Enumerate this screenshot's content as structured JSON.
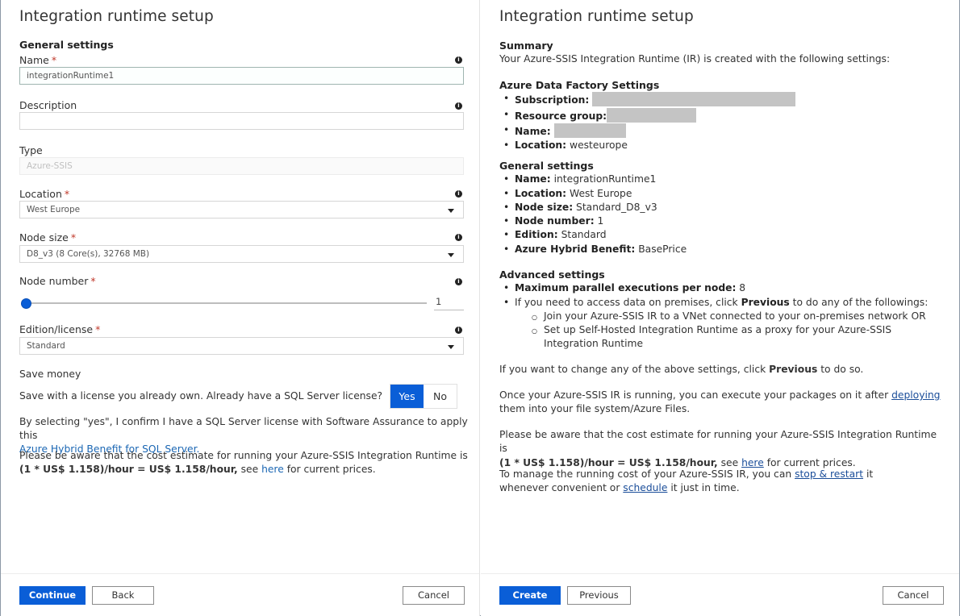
{
  "left_panel": {
    "title": "Integration runtime setup",
    "section": "General settings",
    "required_mark": "*",
    "info_glyph": "i",
    "fields": {
      "name": {
        "label": "Name",
        "value": "integrationRuntime1"
      },
      "description": {
        "label": "Description",
        "value": ""
      },
      "type": {
        "label": "Type",
        "value": "Azure-SSIS"
      },
      "location": {
        "label": "Location",
        "value": "West Europe"
      },
      "node_size": {
        "label": "Node size",
        "value": "D8_v3 (8 Core(s), 32768 MB)"
      },
      "node_number": {
        "label": "Node number",
        "value": "1",
        "slider_fraction": 0.0
      },
      "edition": {
        "label": "Edition/license",
        "value": "Standard"
      }
    },
    "save_money": {
      "heading": "Save money",
      "question": "Save with a license you already own. Already have a SQL Server license?",
      "yes_label": "Yes",
      "no_label": "No",
      "selected": "Yes",
      "confirm_text": "By selecting \"yes\", I confirm I have a SQL Server license with Software Assurance to apply this",
      "confirm_link": "Azure Hybrid Benefit for SQL Server."
    },
    "cost": {
      "prefix": "Please be aware that the cost estimate for running your Azure-SSIS Integration Runtime is",
      "formula": "(1 * US$ 1.158)/hour = US$ 1.158/hour,",
      "see": " see ",
      "link": "here",
      "suffix": " for current prices."
    },
    "buttons": {
      "continue": "Continue",
      "back": "Back",
      "cancel": "Cancel"
    }
  },
  "right_panel": {
    "title": "Integration runtime setup",
    "summary_heading": "Summary",
    "summary_intro": "Your Azure-SSIS Integration Runtime (IR) is created with the following settings:",
    "adf_heading": "Azure Data Factory Settings",
    "adf": [
      {
        "key": "Subscription:",
        "value": "",
        "redacted": true
      },
      {
        "key": "Resource group:",
        "value": "",
        "redacted": true
      },
      {
        "key": "Name:",
        "value": "",
        "redacted": true
      },
      {
        "key": "Location:",
        "value": "westeurope",
        "redacted": false
      }
    ],
    "general_heading": "General settings",
    "general": [
      {
        "key": "Name:",
        "value": "integrationRuntime1"
      },
      {
        "key": "Location:",
        "value": "West Europe"
      },
      {
        "key": "Node size:",
        "value": "Standard_D8_v3"
      },
      {
        "key": "Node number:",
        "value": "1"
      },
      {
        "key": "Edition:",
        "value": "Standard"
      },
      {
        "key": "Azure Hybrid Benefit:",
        "value": "BasePrice"
      }
    ],
    "advanced_heading": "Advanced settings",
    "advanced": {
      "max_parallel_key": "Maximum parallel executions per node:",
      "max_parallel_value": "8",
      "onprem_prefix": "If you need to access data on premises, click ",
      "onprem_bold": "Previous",
      "onprem_suffix": " to do any of the followings:",
      "sub_items": [
        "Join your Azure-SSIS IR to a VNet connected to your on-premises network OR",
        "Set up Self-Hosted Integration Runtime as a proxy for your Azure-SSIS Integration Runtime"
      ]
    },
    "change_prefix": "If you want to change any of the above settings, click ",
    "change_bold": "Previous",
    "change_suffix": " to do so.",
    "deploy_prefix": "Once your Azure-SSIS IR is running, you can execute your packages on it after ",
    "deploy_link": "deploying",
    "deploy_suffix": " them into your file system/Azure Files.",
    "cost_prefix": "Please be aware that the cost estimate for running your Azure-SSIS Integration Runtime is",
    "cost_formula": "(1 * US$ 1.158)/hour = US$ 1.158/hour,",
    "cost_see": " see ",
    "cost_link": "here",
    "cost_suffix": " for current prices.",
    "manage_prefix": "To manage the running cost of your Azure-SSIS IR, you can ",
    "manage_link1": "stop & restart",
    "manage_mid": " it whenever convenient or ",
    "manage_link2": "schedule",
    "manage_suffix": " it just in time.",
    "buttons": {
      "create": "Create",
      "previous": "Previous",
      "cancel": "Cancel"
    }
  },
  "colors": {
    "primary": "#0a5ed7",
    "link": "#1a66b3",
    "required": "#c0392b",
    "redaction": "#c4c4c4"
  }
}
